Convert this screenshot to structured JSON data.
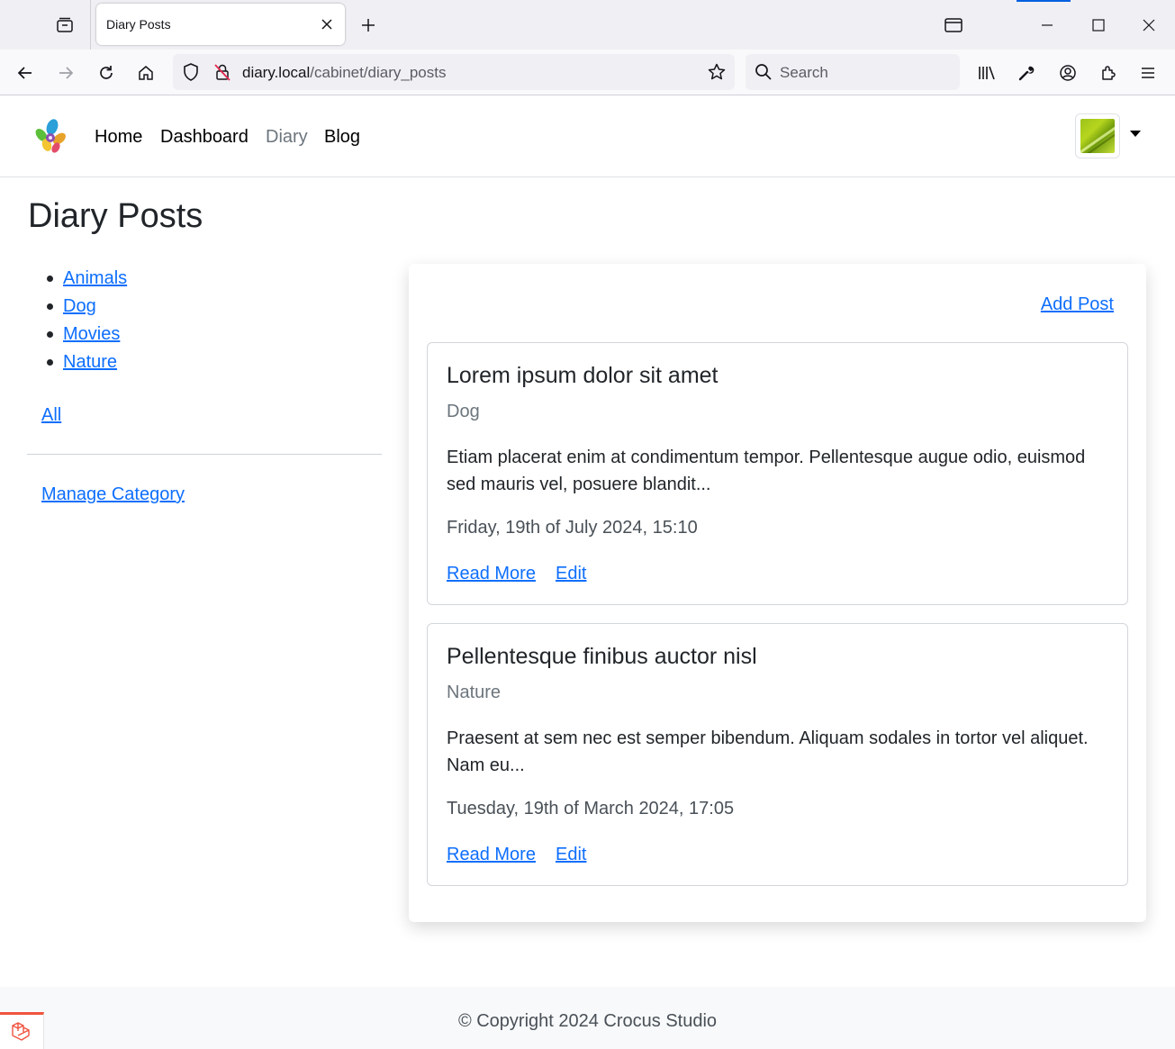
{
  "browser": {
    "tab_title": "Diary Posts",
    "url_host": "diary.local",
    "url_path": "/cabinet/diary_posts",
    "search_placeholder": "Search",
    "accent_color": "#0060df"
  },
  "site": {
    "nav": {
      "home": "Home",
      "dashboard": "Dashboard",
      "diary": "Diary",
      "blog": "Blog"
    },
    "active_nav": "Diary"
  },
  "page": {
    "title": "Diary Posts",
    "categories": [
      {
        "label": "Animals"
      },
      {
        "label": "Dog"
      },
      {
        "label": "Movies"
      },
      {
        "label": "Nature"
      }
    ],
    "all_label": "All",
    "manage_category_label": "Manage Category",
    "add_post_label": "Add Post",
    "posts": [
      {
        "title": "Lorem ipsum dolor sit amet",
        "category": "Dog",
        "excerpt": "Etiam placerat enim at condimentum tempor. Pellentesque augue odio, euismod sed mauris vel, posuere blandit...",
        "date": "Friday, 19th of July 2024, 15:10",
        "read_more_label": "Read More",
        "edit_label": "Edit"
      },
      {
        "title": "Pellentesque finibus auctor nisl",
        "category": "Nature",
        "excerpt": "Praesent at sem nec est semper bibendum. Aliquam sodales in tortor vel aliquet. Nam eu...",
        "date": "Tuesday, 19th of March 2024, 17:05",
        "read_more_label": "Read More",
        "edit_label": "Edit"
      }
    ]
  },
  "footer": {
    "copyright": "© Copyright 2024 Crocus Studio"
  },
  "colors": {
    "link": "#0d6efd",
    "muted": "#6c757d",
    "laravel_red": "#f05340"
  }
}
